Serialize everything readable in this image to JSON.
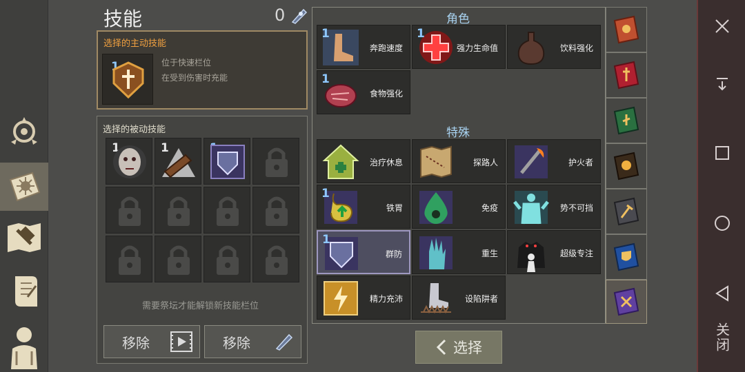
{
  "header": {
    "title": "技能",
    "points": "0"
  },
  "active_skill": {
    "heading": "选择的主动技能",
    "level": "1",
    "desc_line1": "位于快速栏位",
    "desc_line2": "在受到伤害时充能"
  },
  "passive": {
    "heading": "选择的被动技能",
    "slots": [
      {
        "level": "1",
        "icon": "vampire-face-icon"
      },
      {
        "level": "1",
        "icon": "log-triangle-icon"
      },
      {
        "level": "1",
        "icon": "armor-shield-icon"
      }
    ],
    "hint": "需要祭坛才能解锁新技能栏位",
    "remove_ad_label": "移除",
    "remove_gem_label": "移除"
  },
  "sections": {
    "role": "角色",
    "special": "特殊"
  },
  "role_skills": [
    {
      "label": "奔跑速度",
      "level": "1",
      "icon": "running-leg-icon"
    },
    {
      "label": "强力生命值",
      "level": "1",
      "icon": "health-cross-icon"
    },
    {
      "label": "饮料强化",
      "level": "",
      "icon": "potion-flask-icon"
    },
    {
      "label": "食物强化",
      "level": "1",
      "icon": "meat-steak-icon"
    }
  ],
  "special_skills": [
    {
      "label": "治疗休息",
      "level": "",
      "icon": "heal-house-icon"
    },
    {
      "label": "探路人",
      "level": "",
      "icon": "treasure-map-icon"
    },
    {
      "label": "护火者",
      "level": "",
      "icon": "fire-axe-icon"
    },
    {
      "label": "铁胃",
      "level": "1",
      "icon": "stomach-arrow-icon"
    },
    {
      "label": "免疫",
      "level": "",
      "icon": "biohazard-drop-icon"
    },
    {
      "label": "势不可挡",
      "level": "",
      "icon": "unstoppable-figure-icon"
    },
    {
      "label": "群防",
      "level": "1",
      "icon": "group-armor-icon"
    },
    {
      "label": "重生",
      "level": "",
      "icon": "rising-hand-icon"
    },
    {
      "label": "超级专注",
      "level": "",
      "icon": "shadow-focus-icon"
    },
    {
      "label": "精力充沛",
      "level": "",
      "icon": "energy-bolt-icon"
    },
    {
      "label": "设陷阱者",
      "level": "",
      "icon": "trap-foot-icon"
    }
  ],
  "select_label": "选择",
  "system": {
    "close_text": "关闭"
  },
  "colors": {
    "accent": "#a08a64",
    "level_blue": "#8fc8ff",
    "section_blue": "#a8d2f0"
  }
}
